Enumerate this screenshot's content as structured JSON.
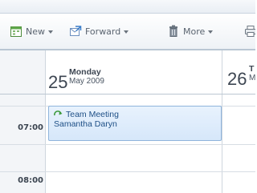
{
  "toolbar": {
    "new_label": "New",
    "forward_label": "Forward",
    "more_label": "More"
  },
  "days": [
    {
      "num": "25",
      "name": "Monday",
      "date": "May 2009"
    },
    {
      "num": "26",
      "name": "T",
      "date": "M"
    }
  ],
  "times": [
    "07:00",
    "08:00"
  ],
  "event": {
    "title": "Team Meeting",
    "person": "Samantha Daryn"
  },
  "colors": {
    "event_fill": "#dbe9fb",
    "event_border": "#8fb4dc",
    "event_text": "#1e4f86"
  },
  "icons": [
    "calendar-new-icon",
    "forward-icon",
    "trash-icon",
    "printer-icon",
    "recurrence-arrow-icon"
  ]
}
